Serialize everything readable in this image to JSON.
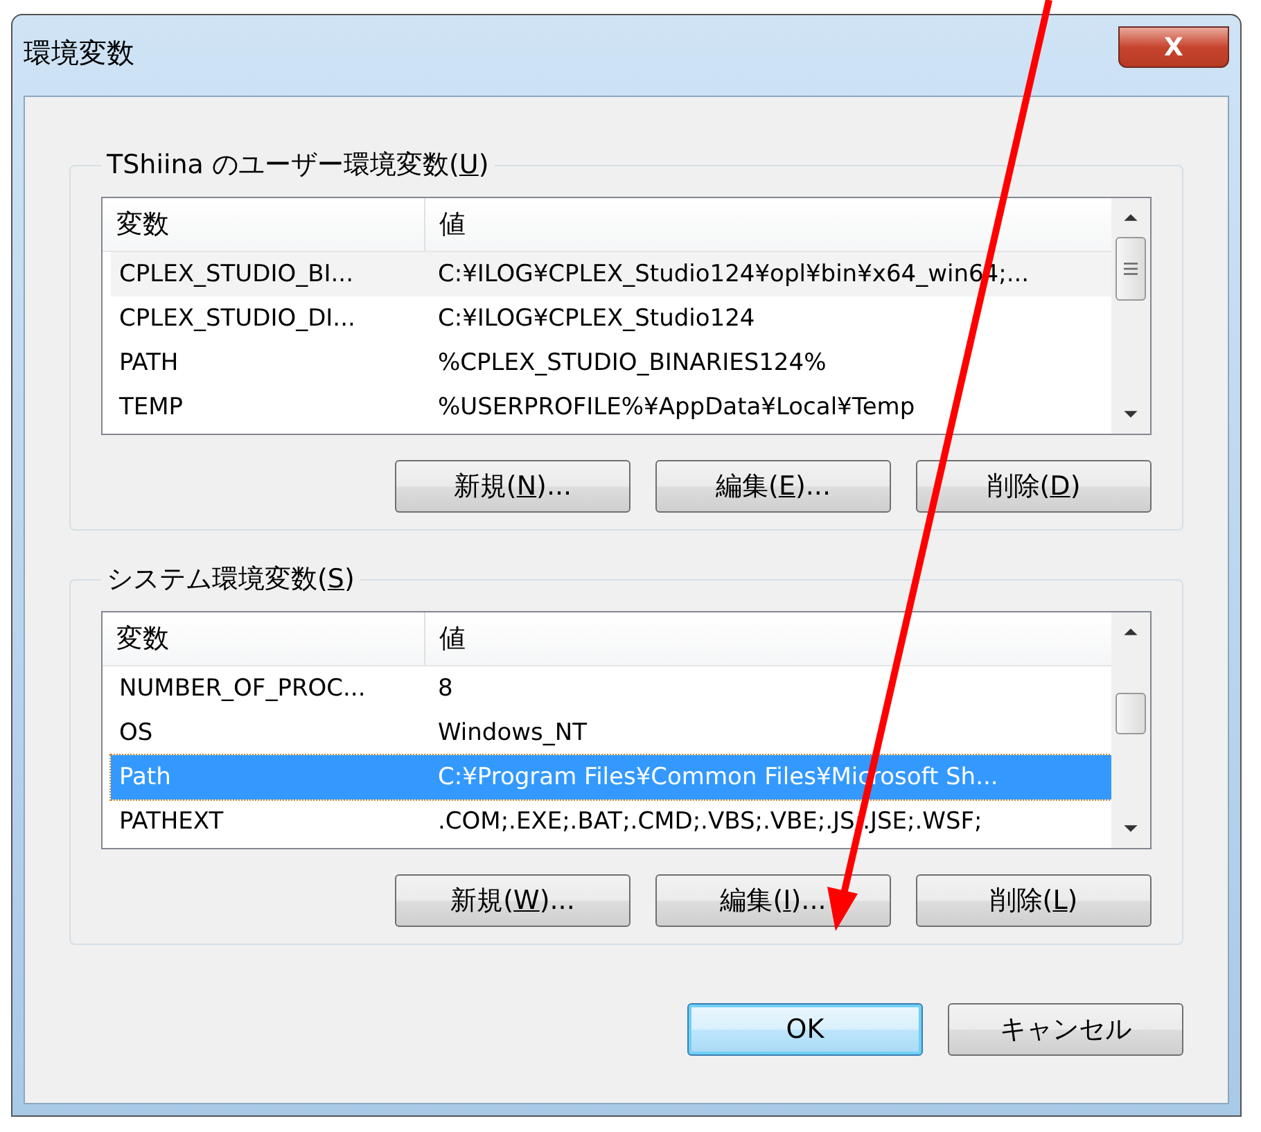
{
  "window": {
    "title": "環境変数",
    "close_label": "X"
  },
  "groups": [
    {
      "title": {
        "before": "TShiina のユーザー環境変数(",
        "key": "U",
        "after": ")"
      },
      "columns": [
        "変数",
        "値"
      ],
      "rows": [
        {
          "name": "CPLEX_STUDIO_BI...",
          "value": "C:¥ILOG¥CPLEX_Studio124¥opl¥bin¥x64_win64;...",
          "selected": false,
          "hover": true
        },
        {
          "name": "CPLEX_STUDIO_DI...",
          "value": "C:¥ILOG¥CPLEX_Studio124",
          "selected": false,
          "hover": false
        },
        {
          "name": "PATH",
          "value": "%CPLEX_STUDIO_BINARIES124%",
          "selected": false,
          "hover": false
        },
        {
          "name": "TEMP",
          "value": "%USERPROFILE%¥AppData¥Local¥Temp",
          "selected": false,
          "hover": false
        }
      ],
      "buttons": [
        {
          "before": "新規(",
          "key": "N",
          "after": ")..."
        },
        {
          "before": "編集(",
          "key": "E",
          "after": ")..."
        },
        {
          "before": "削除(",
          "key": "D",
          "after": ")"
        }
      ]
    },
    {
      "title": {
        "before": "システム環境変数(",
        "key": "S",
        "after": ")"
      },
      "columns": [
        "変数",
        "値"
      ],
      "rows": [
        {
          "name": "NUMBER_OF_PROC...",
          "value": "8",
          "selected": false,
          "hover": false
        },
        {
          "name": "OS",
          "value": "Windows_NT",
          "selected": false,
          "hover": false
        },
        {
          "name": "Path",
          "value": "C:¥Program Files¥Common Files¥Microsoft Sh...",
          "selected": true,
          "hover": false
        },
        {
          "name": "PATHEXT",
          "value": ".COM;.EXE;.BAT;.CMD;.VBS;.VBE;.JS;.JSE;.WSF;",
          "selected": false,
          "hover": false
        }
      ],
      "buttons": [
        {
          "before": "新規(",
          "key": "W",
          "after": ")..."
        },
        {
          "before": "編集(",
          "key": "I",
          "after": ")..."
        },
        {
          "before": "削除(",
          "key": "L",
          "after": ")"
        }
      ]
    }
  ],
  "footer_buttons": [
    {
      "label": "OK",
      "default": true
    },
    {
      "label": "キャンセル",
      "default": false
    }
  ],
  "annotation": {
    "kind": "arrow"
  }
}
